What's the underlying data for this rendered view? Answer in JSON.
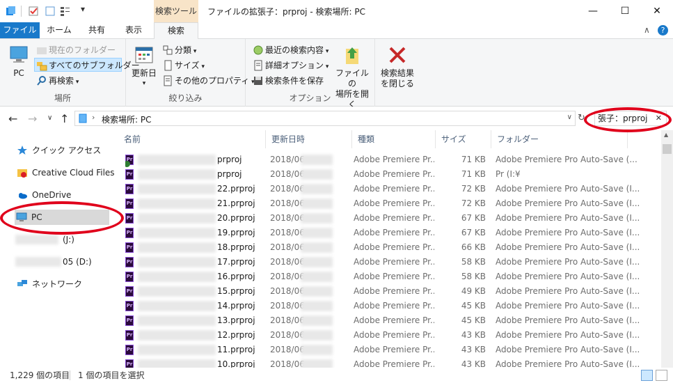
{
  "window": {
    "title": "ファイルの拡張子：prproj - 検索場所: PC",
    "context_tab_header": "検索ツール",
    "minimize": "—",
    "maximize": "☐",
    "close": "✕"
  },
  "tabs": {
    "file": "ファイル",
    "home": "ホーム",
    "share": "共有",
    "view": "表示",
    "search": "検索",
    "help": "?"
  },
  "ribbon": {
    "location": {
      "label": "場所",
      "pc": "PC",
      "current_folder": "現在のフォルダー",
      "all_subfolders": "すべてのサブフォルダー",
      "search_again": "再検索"
    },
    "refine": {
      "label": "絞り込み",
      "date_modified": "更新日",
      "kind": "分類",
      "size": "サイズ",
      "other_properties": "その他のプロパティ"
    },
    "options": {
      "label": "オプション",
      "recent_searches": "最近の検索内容",
      "advanced_options": "詳細オプション",
      "save_search": "検索条件を保存",
      "open_file_location_1": "ファイルの",
      "open_file_location_2": "場所を開く",
      "close_search_1": "検索結果",
      "close_search_2": "を閉じる"
    }
  },
  "address": {
    "path": "検索場所: PC",
    "search_query": "張子：prproj"
  },
  "navpane": {
    "items": [
      {
        "label": "クイック アクセス"
      },
      {
        "label": "Creative Cloud Files"
      },
      {
        "label": "OneDrive"
      },
      {
        "label": "PC"
      },
      {
        "label": "(J:)"
      },
      {
        "label": "05 (D:)"
      },
      {
        "label": "ネットワーク"
      }
    ]
  },
  "columns": {
    "name": "名前",
    "date": "更新日時",
    "type": "種類",
    "size": "サイズ",
    "folder": "フォルダー"
  },
  "files": [
    {
      "name": "prproj",
      "date": "2018/06",
      "type": "Adobe Premiere Pr...",
      "size": "71 KB",
      "folder": "Adobe Premiere Pro Auto-Save (..."
    },
    {
      "name": "prproj",
      "date": "2018/06",
      "type": "Adobe Premiere Pr...",
      "size": "71 KB",
      "folder": "Pr (I:¥"
    },
    {
      "name": "22.prproj",
      "date": "2018/06",
      "type": "Adobe Premiere Pr...",
      "size": "72 KB",
      "folder": "Adobe Premiere Pro Auto-Save (I..."
    },
    {
      "name": "21.prproj",
      "date": "2018/06",
      "type": "Adobe Premiere Pr...",
      "size": "72 KB",
      "folder": "Adobe Premiere Pro Auto-Save (I..."
    },
    {
      "name": "20.prproj",
      "date": "2018/06",
      "type": "Adobe Premiere Pr...",
      "size": "67 KB",
      "folder": "Adobe Premiere Pro Auto-Save (I..."
    },
    {
      "name": "19.prproj",
      "date": "2018/06",
      "type": "Adobe Premiere Pr...",
      "size": "67 KB",
      "folder": "Adobe Premiere Pro Auto-Save (I..."
    },
    {
      "name": "18.prproj",
      "date": "2018/06",
      "type": "Adobe Premiere Pr...",
      "size": "66 KB",
      "folder": "Adobe Premiere Pro Auto-Save (I..."
    },
    {
      "name": "17.prproj",
      "date": "2018/06",
      "type": "Adobe Premiere Pr...",
      "size": "58 KB",
      "folder": "Adobe Premiere Pro Auto-Save (I..."
    },
    {
      "name": "16.prproj",
      "date": "2018/06",
      "type": "Adobe Premiere Pr...",
      "size": "58 KB",
      "folder": "Adobe Premiere Pro Auto-Save (I..."
    },
    {
      "name": "15.prproj",
      "date": "2018/06",
      "type": "Adobe Premiere Pr...",
      "size": "49 KB",
      "folder": "Adobe Premiere Pro Auto-Save (I..."
    },
    {
      "name": "14.prproj",
      "date": "2018/06",
      "type": "Adobe Premiere Pr...",
      "size": "45 KB",
      "folder": "Adobe Premiere Pro Auto-Save (I..."
    },
    {
      "name": "13.prproj",
      "date": "2018/06",
      "type": "Adobe Premiere Pr...",
      "size": "45 KB",
      "folder": "Adobe Premiere Pro Auto-Save (I..."
    },
    {
      "name": "12.prproj",
      "date": "2018/06",
      "type": "Adobe Premiere Pr...",
      "size": "43 KB",
      "folder": "Adobe Premiere Pro Auto-Save (I..."
    },
    {
      "name": "11.prproj",
      "date": "2018/06",
      "type": "Adobe Premiere Pr...",
      "size": "43 KB",
      "folder": "Adobe Premiere Pro Auto-Save (I..."
    },
    {
      "name": "10.prproj",
      "date": "2018/06",
      "type": "Adobe Premiere Pr...",
      "size": "43 KB",
      "folder": "Adobe Premiere Pro Auto-Save (I..."
    }
  ],
  "status": {
    "item_count": "1,229 個の項目",
    "selection": "1 個の項目を選択"
  },
  "colors": {
    "file_tab": "#1979ca",
    "context_tab": "#f8e4c8",
    "selection": "#cce8ff",
    "annotation": "#e0001b"
  }
}
